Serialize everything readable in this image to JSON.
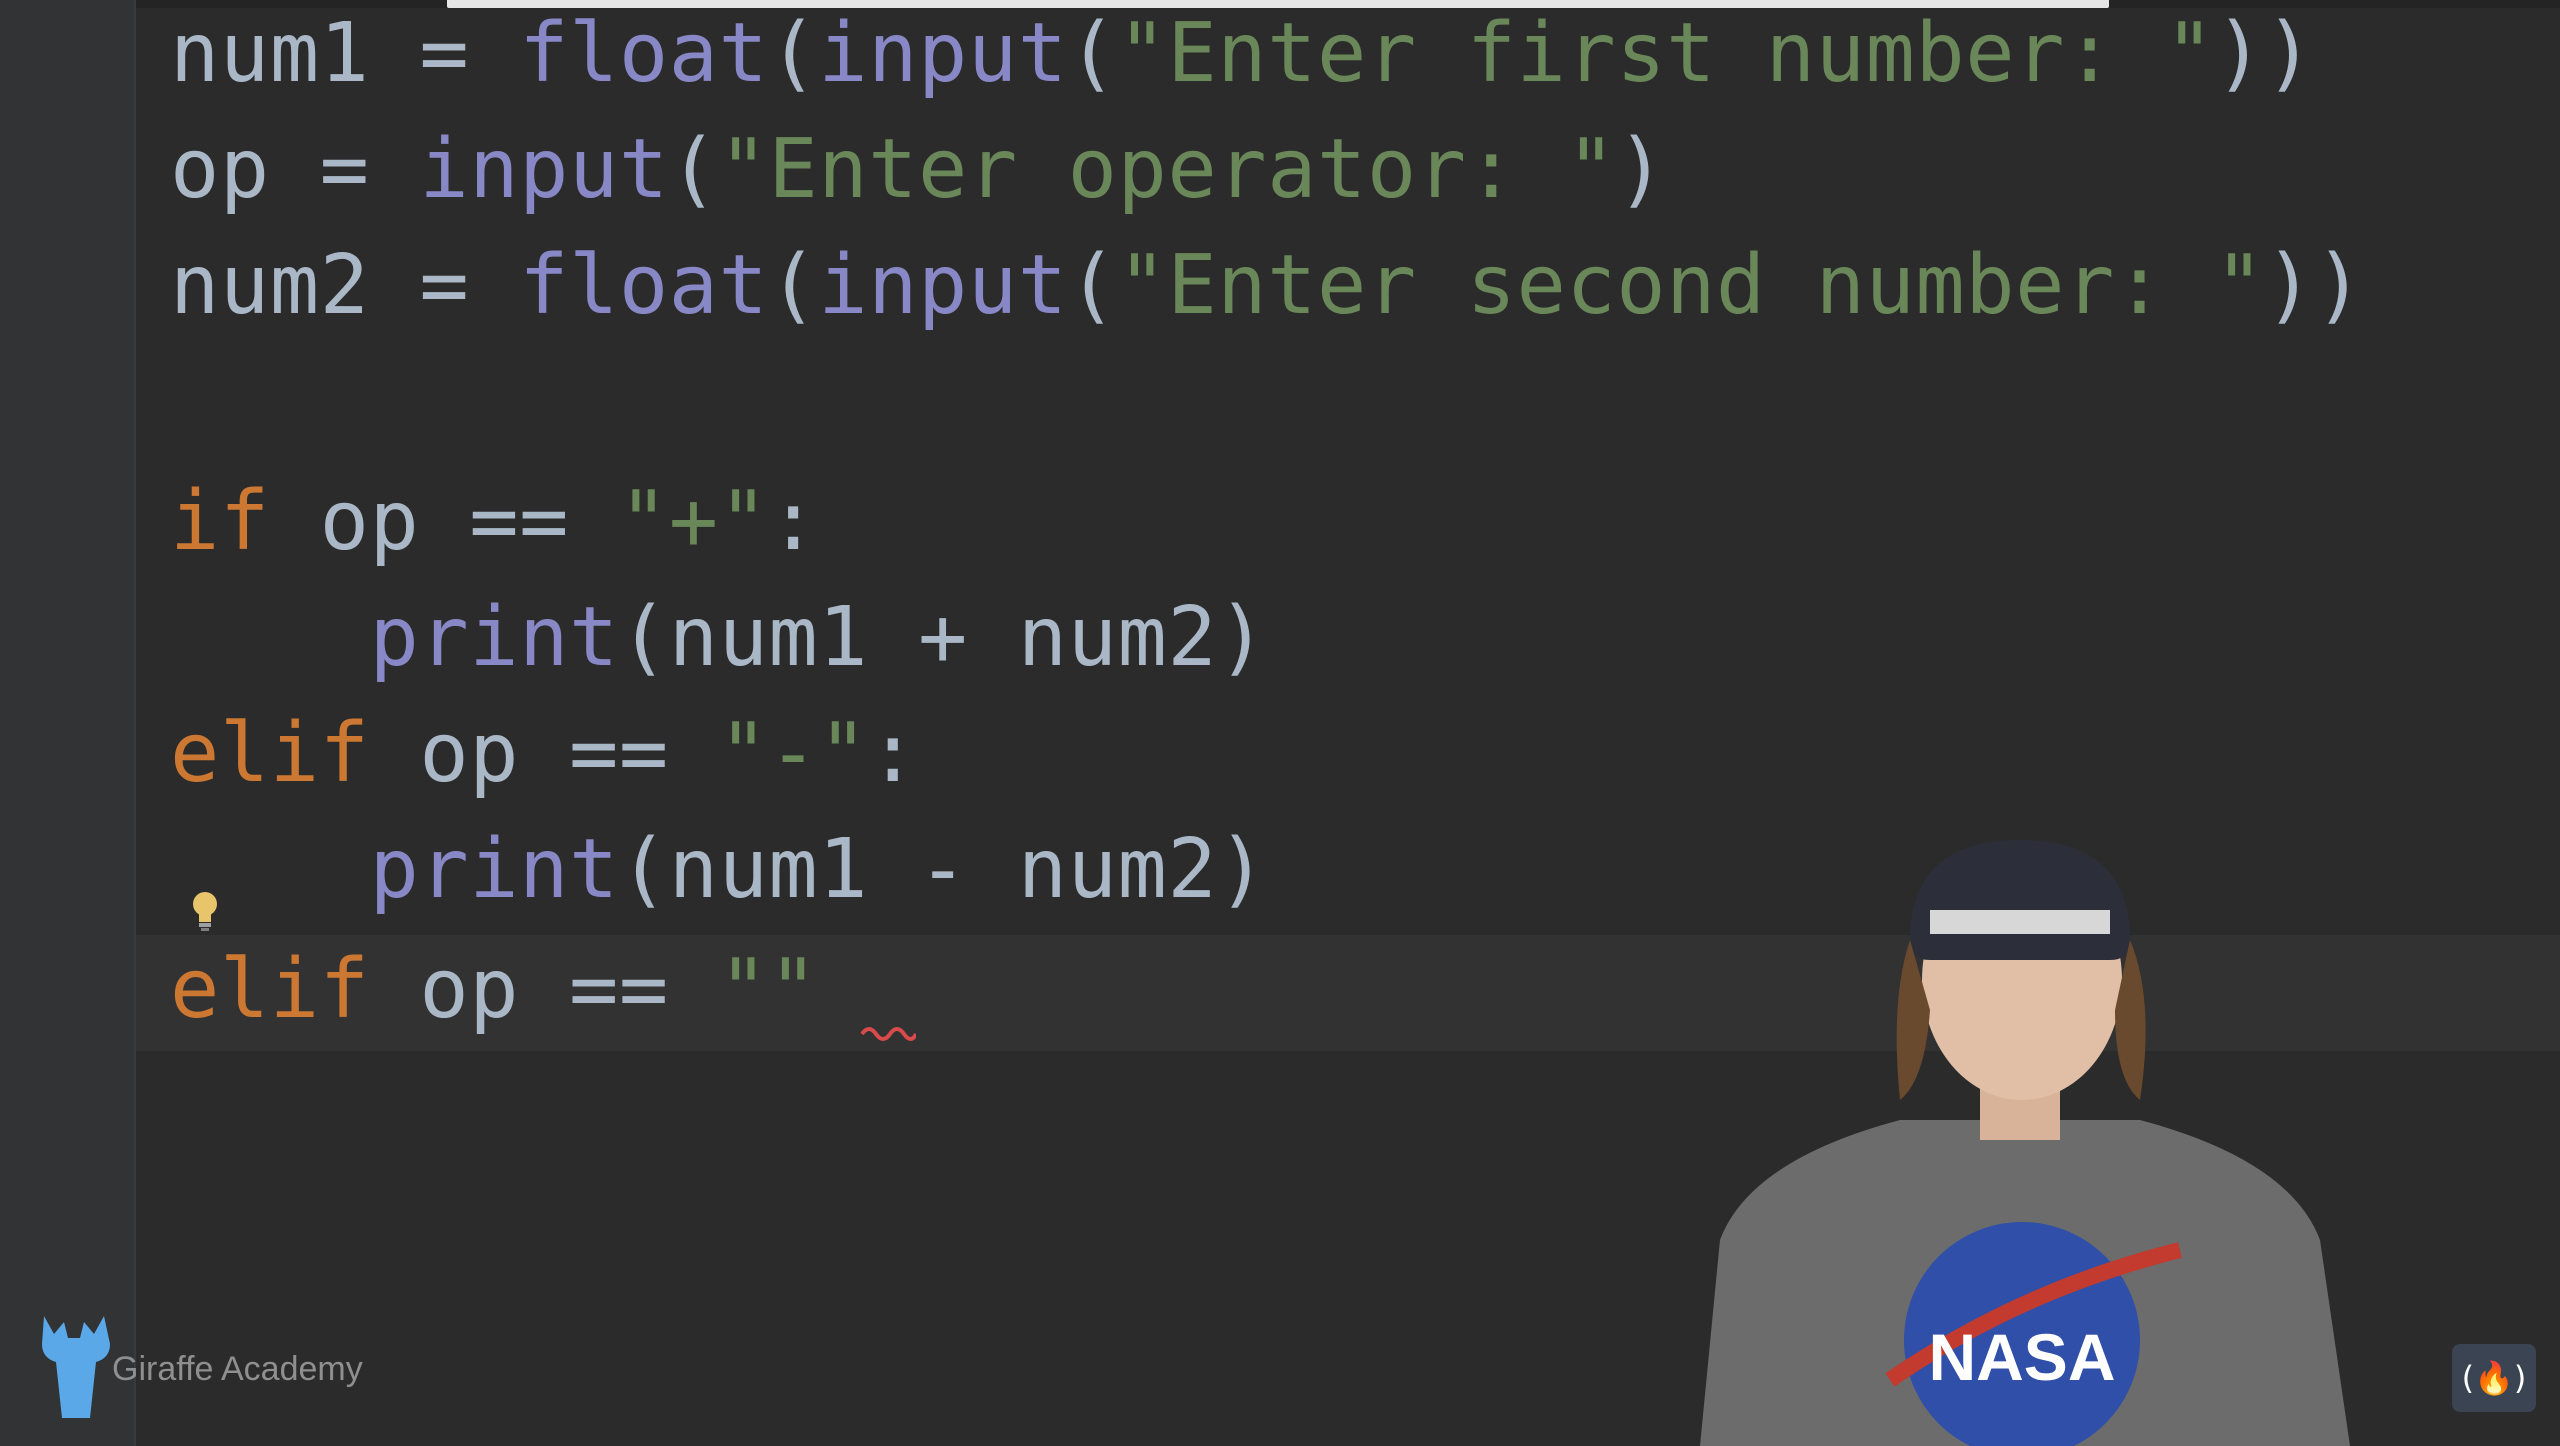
{
  "editor": {
    "lines": [
      {
        "tokens": [
          {
            "t": "num1 = ",
            "c": "op"
          },
          {
            "t": "float",
            "c": "fn"
          },
          {
            "t": "(",
            "c": "op"
          },
          {
            "t": "input",
            "c": "fn"
          },
          {
            "t": "(",
            "c": "op"
          },
          {
            "t": "\"Enter first number: \"",
            "c": "str"
          },
          {
            "t": "))",
            "c": "op"
          }
        ]
      },
      {
        "tokens": [
          {
            "t": "op = ",
            "c": "op"
          },
          {
            "t": "input",
            "c": "fn"
          },
          {
            "t": "(",
            "c": "op"
          },
          {
            "t": "\"Enter operator: \"",
            "c": "str"
          },
          {
            "t": ")",
            "c": "op"
          }
        ]
      },
      {
        "tokens": [
          {
            "t": "num2 = ",
            "c": "op"
          },
          {
            "t": "float",
            "c": "fn"
          },
          {
            "t": "(",
            "c": "op"
          },
          {
            "t": "input",
            "c": "fn"
          },
          {
            "t": "(",
            "c": "op"
          },
          {
            "t": "\"Enter second number: \"",
            "c": "str"
          },
          {
            "t": "))",
            "c": "op"
          }
        ]
      },
      {
        "tokens": []
      },
      {
        "tokens": [
          {
            "t": "if",
            "c": "kw"
          },
          {
            "t": " op == ",
            "c": "op"
          },
          {
            "t": "\"+\"",
            "c": "str"
          },
          {
            "t": ":",
            "c": "op"
          }
        ]
      },
      {
        "tokens": [
          {
            "t": "    ",
            "c": "ws"
          },
          {
            "t": "print",
            "c": "fn"
          },
          {
            "t": "(num1 + num2)",
            "c": "op"
          }
        ]
      },
      {
        "tokens": [
          {
            "t": "elif",
            "c": "kw"
          },
          {
            "t": " op == ",
            "c": "op"
          },
          {
            "t": "\"-\"",
            "c": "str"
          },
          {
            "t": ":",
            "c": "op"
          }
        ]
      },
      {
        "tokens": [
          {
            "t": "    ",
            "c": "ws"
          },
          {
            "t": "print",
            "c": "fn"
          },
          {
            "t": "(num1 - num2)",
            "c": "op"
          }
        ]
      },
      {
        "tokens": [
          {
            "t": "elif",
            "c": "kw"
          },
          {
            "t": " op == ",
            "c": "op"
          },
          {
            "t": "\"\"",
            "c": "str"
          }
        ]
      }
    ]
  },
  "watermark": {
    "logo_icon": "giraffe-icon",
    "text": "Giraffe Academy"
  },
  "badge": {
    "icon": "freecodecamp-icon",
    "text": "(🔥)"
  },
  "presenter": {
    "shirt_text": "NASA"
  },
  "colors": {
    "background": "#2b2b2b",
    "keyword": "#cc7832",
    "builtin": "#8888c6",
    "string": "#6a8759",
    "text": "#a9b7c6"
  }
}
